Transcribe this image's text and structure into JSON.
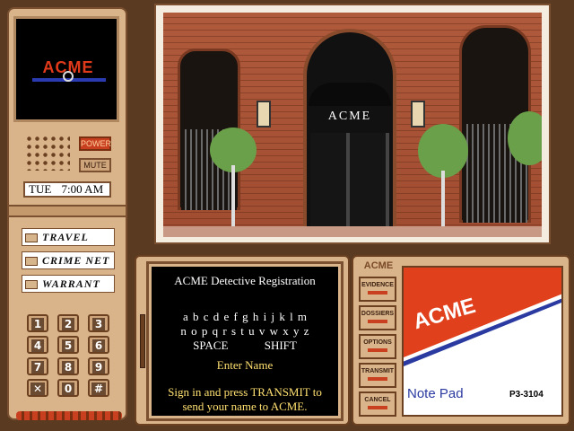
{
  "device": {
    "logo": "ACME",
    "power_label": "POWER",
    "mute_label": "MUTE",
    "day": "TUE",
    "time": "7:00 AM",
    "menu": [
      {
        "label": "TRAVEL"
      },
      {
        "label": "CRIME NET"
      },
      {
        "label": "WARRANT"
      }
    ],
    "keys": [
      "1",
      "2",
      "3",
      "4",
      "5",
      "6",
      "7",
      "8",
      "9",
      "✕",
      "0",
      "#"
    ]
  },
  "scene": {
    "sign": "ACME"
  },
  "terminal": {
    "title": "ACME Detective Registration",
    "row1": "a b c d e f g h i j k l m",
    "row2": "n o p q r s t u v w x y z",
    "space": "SPACE",
    "shift": "SHIFT",
    "prompt": "Enter Name",
    "instruction1": "Sign in and press TRANSMIT to",
    "instruction2": "send your name to ACME."
  },
  "side_panel": {
    "header": "ACME",
    "buttons": [
      "EVIDENCE",
      "DOSSIERS",
      "OPTIONS",
      "TRANSMIT",
      "CANCEL"
    ]
  },
  "notepad": {
    "logo": "ACME",
    "label": "Note Pad",
    "code": "P3-3104"
  },
  "colors": {
    "background": "#5a3b22",
    "device_tan": "#d9b48a",
    "accent_red": "#c8401f",
    "notepad_red": "#e0401c",
    "notepad_blue": "#2a3aa0"
  }
}
